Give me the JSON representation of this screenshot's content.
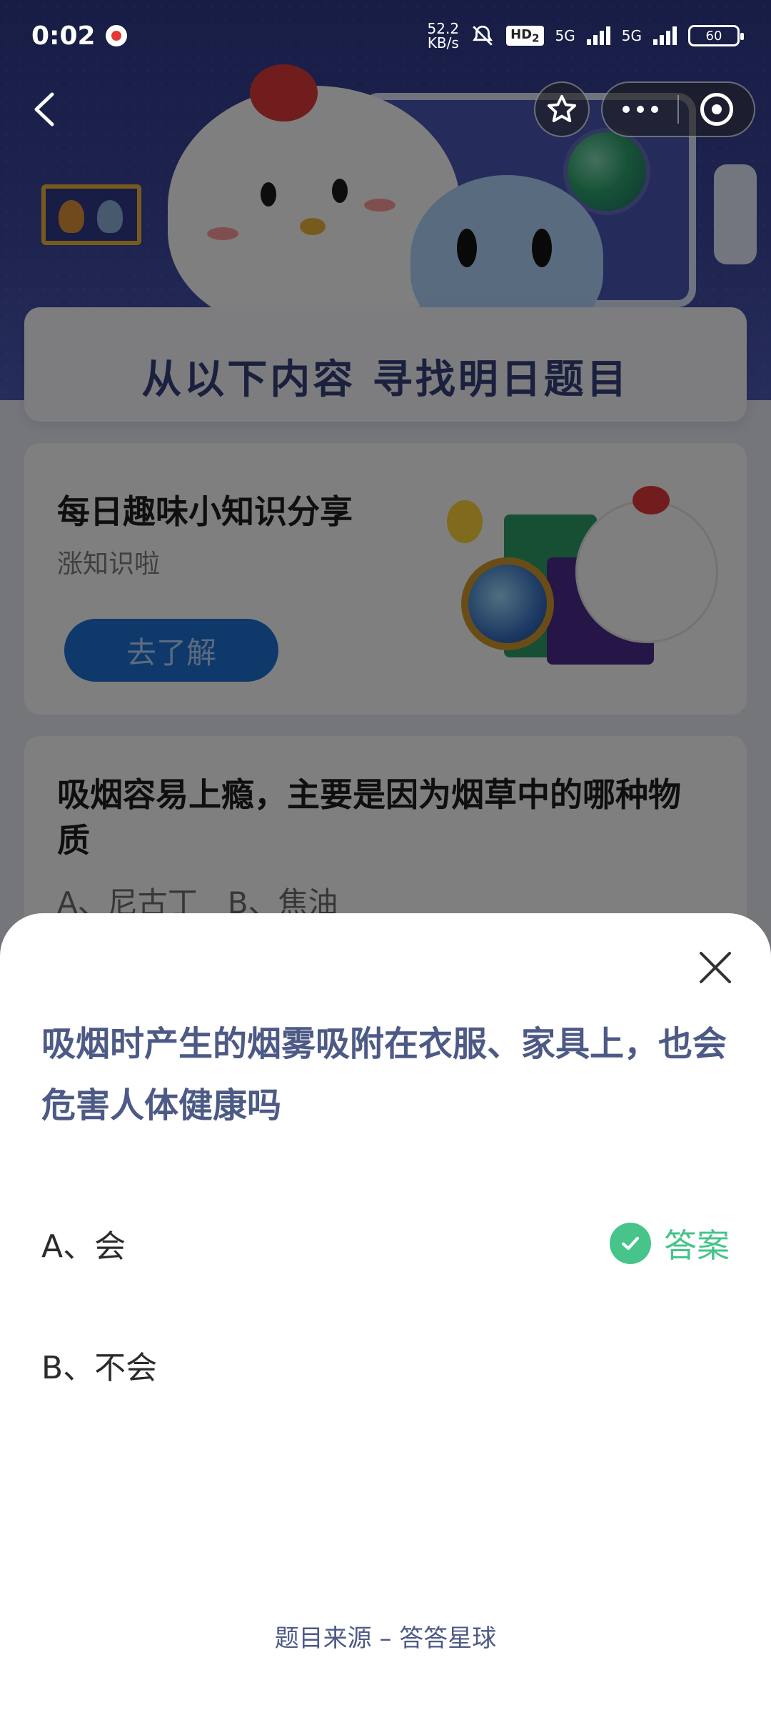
{
  "status_bar": {
    "time": "0:02",
    "net_speed_value": "52.2",
    "net_speed_unit": "KB/s",
    "hd_label": "HD",
    "hd_sub": "2",
    "network1": "5G",
    "network2": "5G",
    "battery": "60",
    "app_notification_icon": "weibo-icon"
  },
  "nav": {
    "back_icon": "chevron-left-icon",
    "favorite_icon": "star-icon",
    "more_icon": "more-dots-icon",
    "close_app_icon": "target-icon"
  },
  "background": {
    "header_banner": "从以下内容 寻找明日题目",
    "knowledge_card": {
      "title": "每日趣味小知识分享",
      "subtitle": "涨知识啦",
      "button": "去了解"
    },
    "question_card": {
      "title": "吸烟容易上瘾，主要是因为烟草中的哪种物质",
      "options": "A、尼古丁　B、焦油"
    }
  },
  "sheet": {
    "question": "吸烟时产生的烟雾吸附在衣服、家具上，也会危害人体健康吗",
    "options": [
      {
        "label": "A、会",
        "is_answer": true
      },
      {
        "label": "B、不会",
        "is_answer": false
      }
    ],
    "answer_label": "答案",
    "source": "题目来源 – 答答星球",
    "close_icon": "close-icon"
  },
  "colors": {
    "accent_text": "#4d5a86",
    "answer_green": "#46c48a"
  }
}
